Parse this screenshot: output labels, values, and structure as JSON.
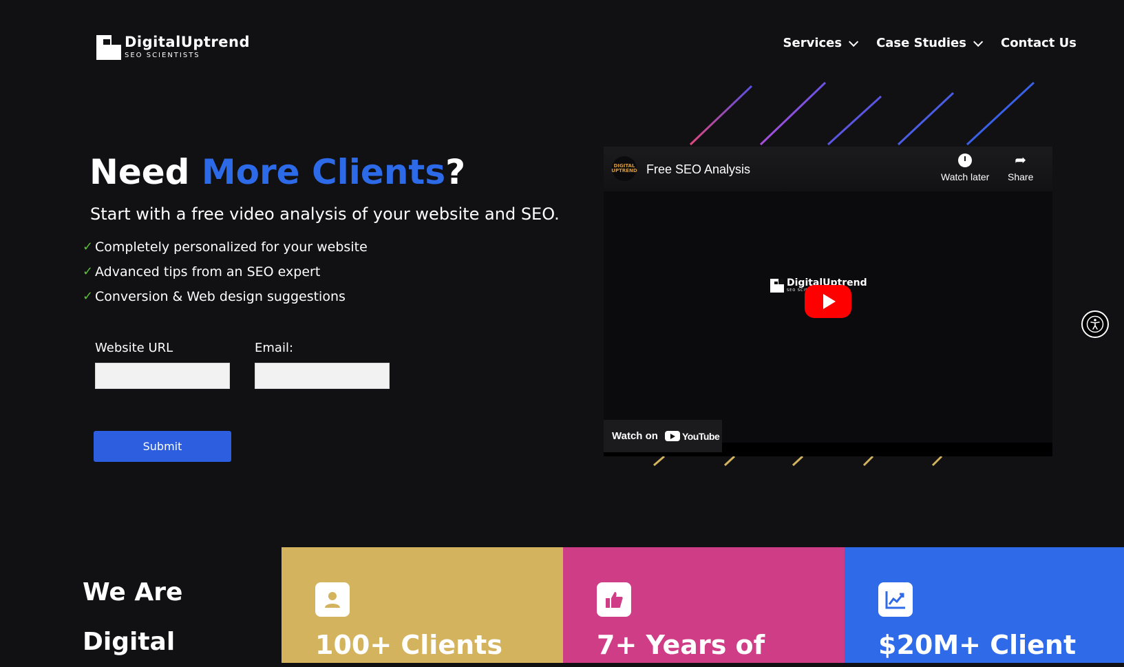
{
  "brand": {
    "name": "DigitalUptrend",
    "tagline": "SEO SCIENTISTS"
  },
  "nav": {
    "items": [
      {
        "label": "Services"
      },
      {
        "label": "Case Studies"
      },
      {
        "label": "Contact Us"
      }
    ]
  },
  "hero": {
    "headline_prefix": "Need ",
    "headline_accent": "More Clients",
    "headline_suffix": "?",
    "subheadline": "Start with a free video analysis of your website and SEO.",
    "checklist": [
      "Completely personalized for your website",
      "Advanced tips from an SEO expert",
      "Conversion & Web design suggestions"
    ]
  },
  "form": {
    "url_label": "Website URL",
    "url_value": "",
    "email_label": "Email:",
    "email_value": "",
    "submit_label": "Submit"
  },
  "video": {
    "title": "Free SEO Analysis",
    "watch_later_label": "Watch later",
    "share_label": "Share",
    "watch_on_label": "Watch on",
    "youtube_label": "YouTube",
    "channel_badge": "DIGITAL UPTREND",
    "thumb_brand": "DigitalUptrend",
    "thumb_tagline": "SEO SCIENTISTS"
  },
  "stats": {
    "intro_line1": "We Are",
    "intro_line2": "Digital",
    "cards": [
      {
        "title": "100+ Clients",
        "color": "#d4b35f",
        "icon": "user-icon"
      },
      {
        "title": "7+ Years of",
        "color": "#cf3d87",
        "icon": "thumbs-up-icon"
      },
      {
        "title": "$20M+ Client",
        "color": "#2f6ae8",
        "icon": "chart-line-icon"
      }
    ]
  },
  "colors": {
    "background": "#111114",
    "accent": "#2d6ae8",
    "check": "#5bbf3a",
    "submit": "#2d5ee0"
  }
}
